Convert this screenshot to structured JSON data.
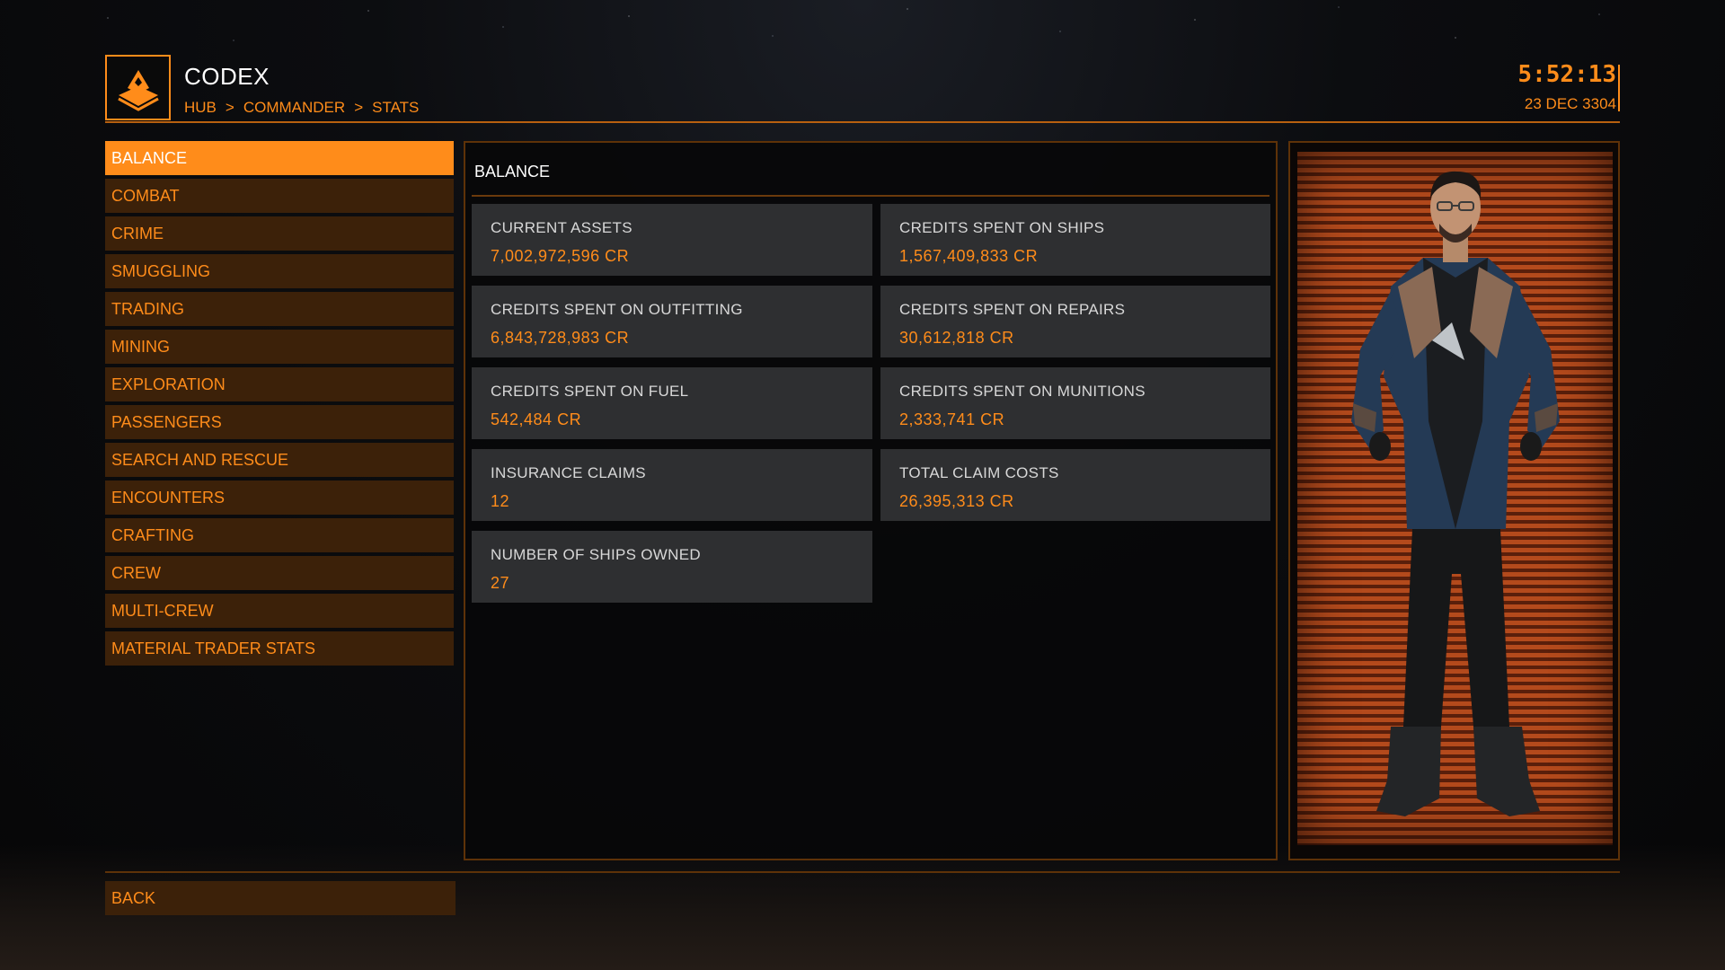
{
  "header": {
    "title": "CODEX",
    "breadcrumb": [
      "HUB",
      ">",
      "COMMANDER",
      ">",
      "STATS"
    ],
    "time": "5:52:13",
    "date": "23 DEC 3304",
    "logo_icon": "codex-book-icon"
  },
  "sidebar": {
    "items": [
      {
        "label": "BALANCE",
        "active": true
      },
      {
        "label": "COMBAT"
      },
      {
        "label": "CRIME"
      },
      {
        "label": "SMUGGLING"
      },
      {
        "label": "TRADING"
      },
      {
        "label": "MINING"
      },
      {
        "label": "EXPLORATION"
      },
      {
        "label": "PASSENGERS"
      },
      {
        "label": "SEARCH AND RESCUE"
      },
      {
        "label": "ENCOUNTERS"
      },
      {
        "label": "CRAFTING"
      },
      {
        "label": "CREW"
      },
      {
        "label": "MULTI-CREW"
      },
      {
        "label": "MATERIAL TRADER STATS"
      }
    ]
  },
  "panel": {
    "title": "BALANCE",
    "stats": [
      {
        "label": "CURRENT ASSETS",
        "value": "7,002,972,596 CR"
      },
      {
        "label": "CREDITS SPENT ON SHIPS",
        "value": "1,567,409,833 CR"
      },
      {
        "label": "CREDITS SPENT ON OUTFITTING",
        "value": "6,843,728,983 CR"
      },
      {
        "label": "CREDITS SPENT ON REPAIRS",
        "value": "30,612,818 CR"
      },
      {
        "label": "CREDITS SPENT ON FUEL",
        "value": "542,484 CR"
      },
      {
        "label": "CREDITS SPENT ON MUNITIONS",
        "value": "2,333,741 CR"
      },
      {
        "label": "INSURANCE CLAIMS",
        "value": "12"
      },
      {
        "label": "TOTAL CLAIM COSTS",
        "value": "26,395,313 CR"
      },
      {
        "label": "NUMBER OF SHIPS OWNED",
        "value": "27"
      }
    ]
  },
  "footer": {
    "back_label": "BACK"
  },
  "colors": {
    "accent": "#ff8c1a",
    "nav_bg": "#3c2109",
    "card_bg": "#2e2f31",
    "text_white": "#ffffff"
  }
}
